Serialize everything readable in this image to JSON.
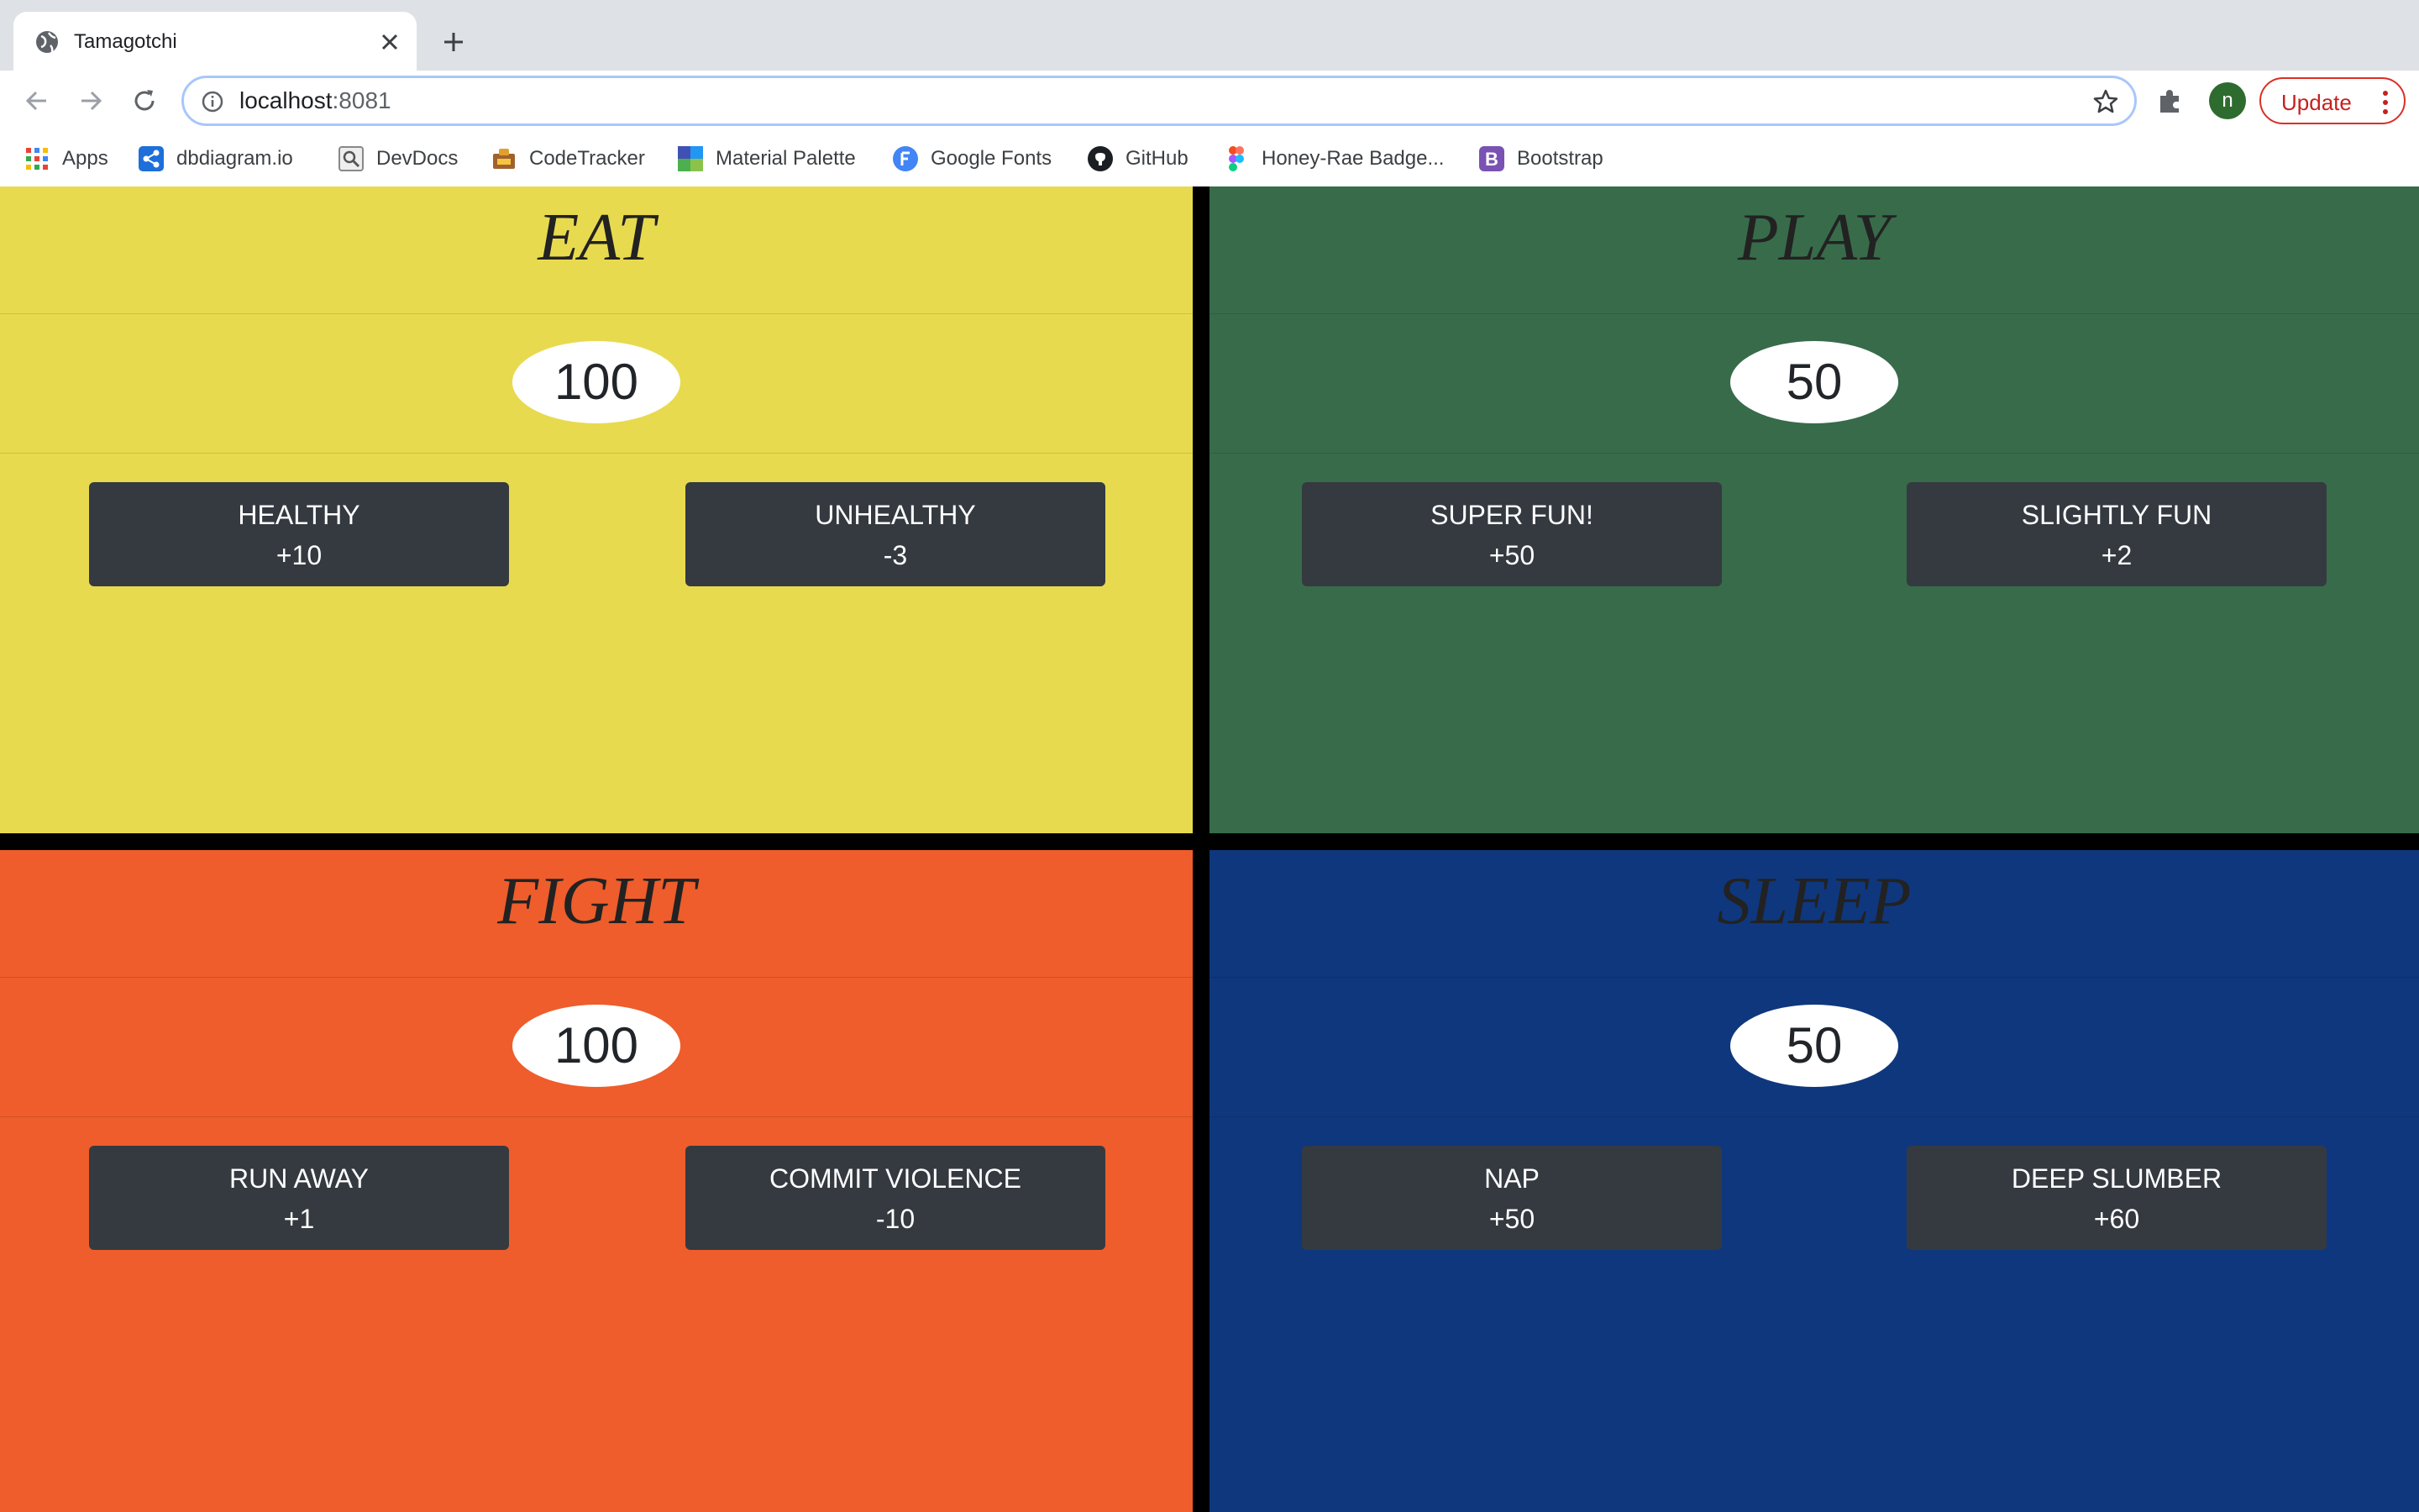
{
  "browser": {
    "tab_title": "Tamagotchi",
    "url_host": "localhost",
    "url_port": ":8081",
    "profile_initial": "n",
    "update_label": "Update",
    "bookmarks": [
      {
        "label": "Apps",
        "icon": "apps-grid-icon"
      },
      {
        "label": "dbdiagram.io",
        "icon": "dbdiagram-icon"
      },
      {
        "label": "DevDocs",
        "icon": "devdocs-icon"
      },
      {
        "label": "CodeTracker",
        "icon": "codetracker-icon"
      },
      {
        "label": "Material Palette",
        "icon": "material-palette-icon"
      },
      {
        "label": "Google Fonts",
        "icon": "google-fonts-icon"
      },
      {
        "label": "GitHub",
        "icon": "github-icon"
      },
      {
        "label": "Honey-Rae Badge...",
        "icon": "figma-icon"
      },
      {
        "label": "Bootstrap",
        "icon": "bootstrap-icon"
      }
    ]
  },
  "panels": {
    "eat": {
      "title": "EAT",
      "score": "100",
      "color": "#e8da4f",
      "buttons": [
        {
          "label": "HEALTHY",
          "value": "+10"
        },
        {
          "label": "UNHEALTHY",
          "value": "-3"
        }
      ]
    },
    "play": {
      "title": "PLAY",
      "score": "50",
      "color": "#386b4a",
      "buttons": [
        {
          "label": "SUPER FUN!",
          "value": "+50"
        },
        {
          "label": "SLIGHTLY FUN",
          "value": "+2"
        }
      ]
    },
    "fight": {
      "title": "FIGHT",
      "score": "100",
      "color": "#ee5d2b",
      "buttons": [
        {
          "label": "RUN AWAY",
          "value": "+1"
        },
        {
          "label": "COMMIT VIOLENCE",
          "value": "-10"
        }
      ]
    },
    "sleep": {
      "title": "SLEEP",
      "score": "50",
      "color": "#0f377d",
      "buttons": [
        {
          "label": "NAP",
          "value": "+50"
        },
        {
          "label": "DEEP SLUMBER",
          "value": "+60"
        }
      ]
    }
  }
}
